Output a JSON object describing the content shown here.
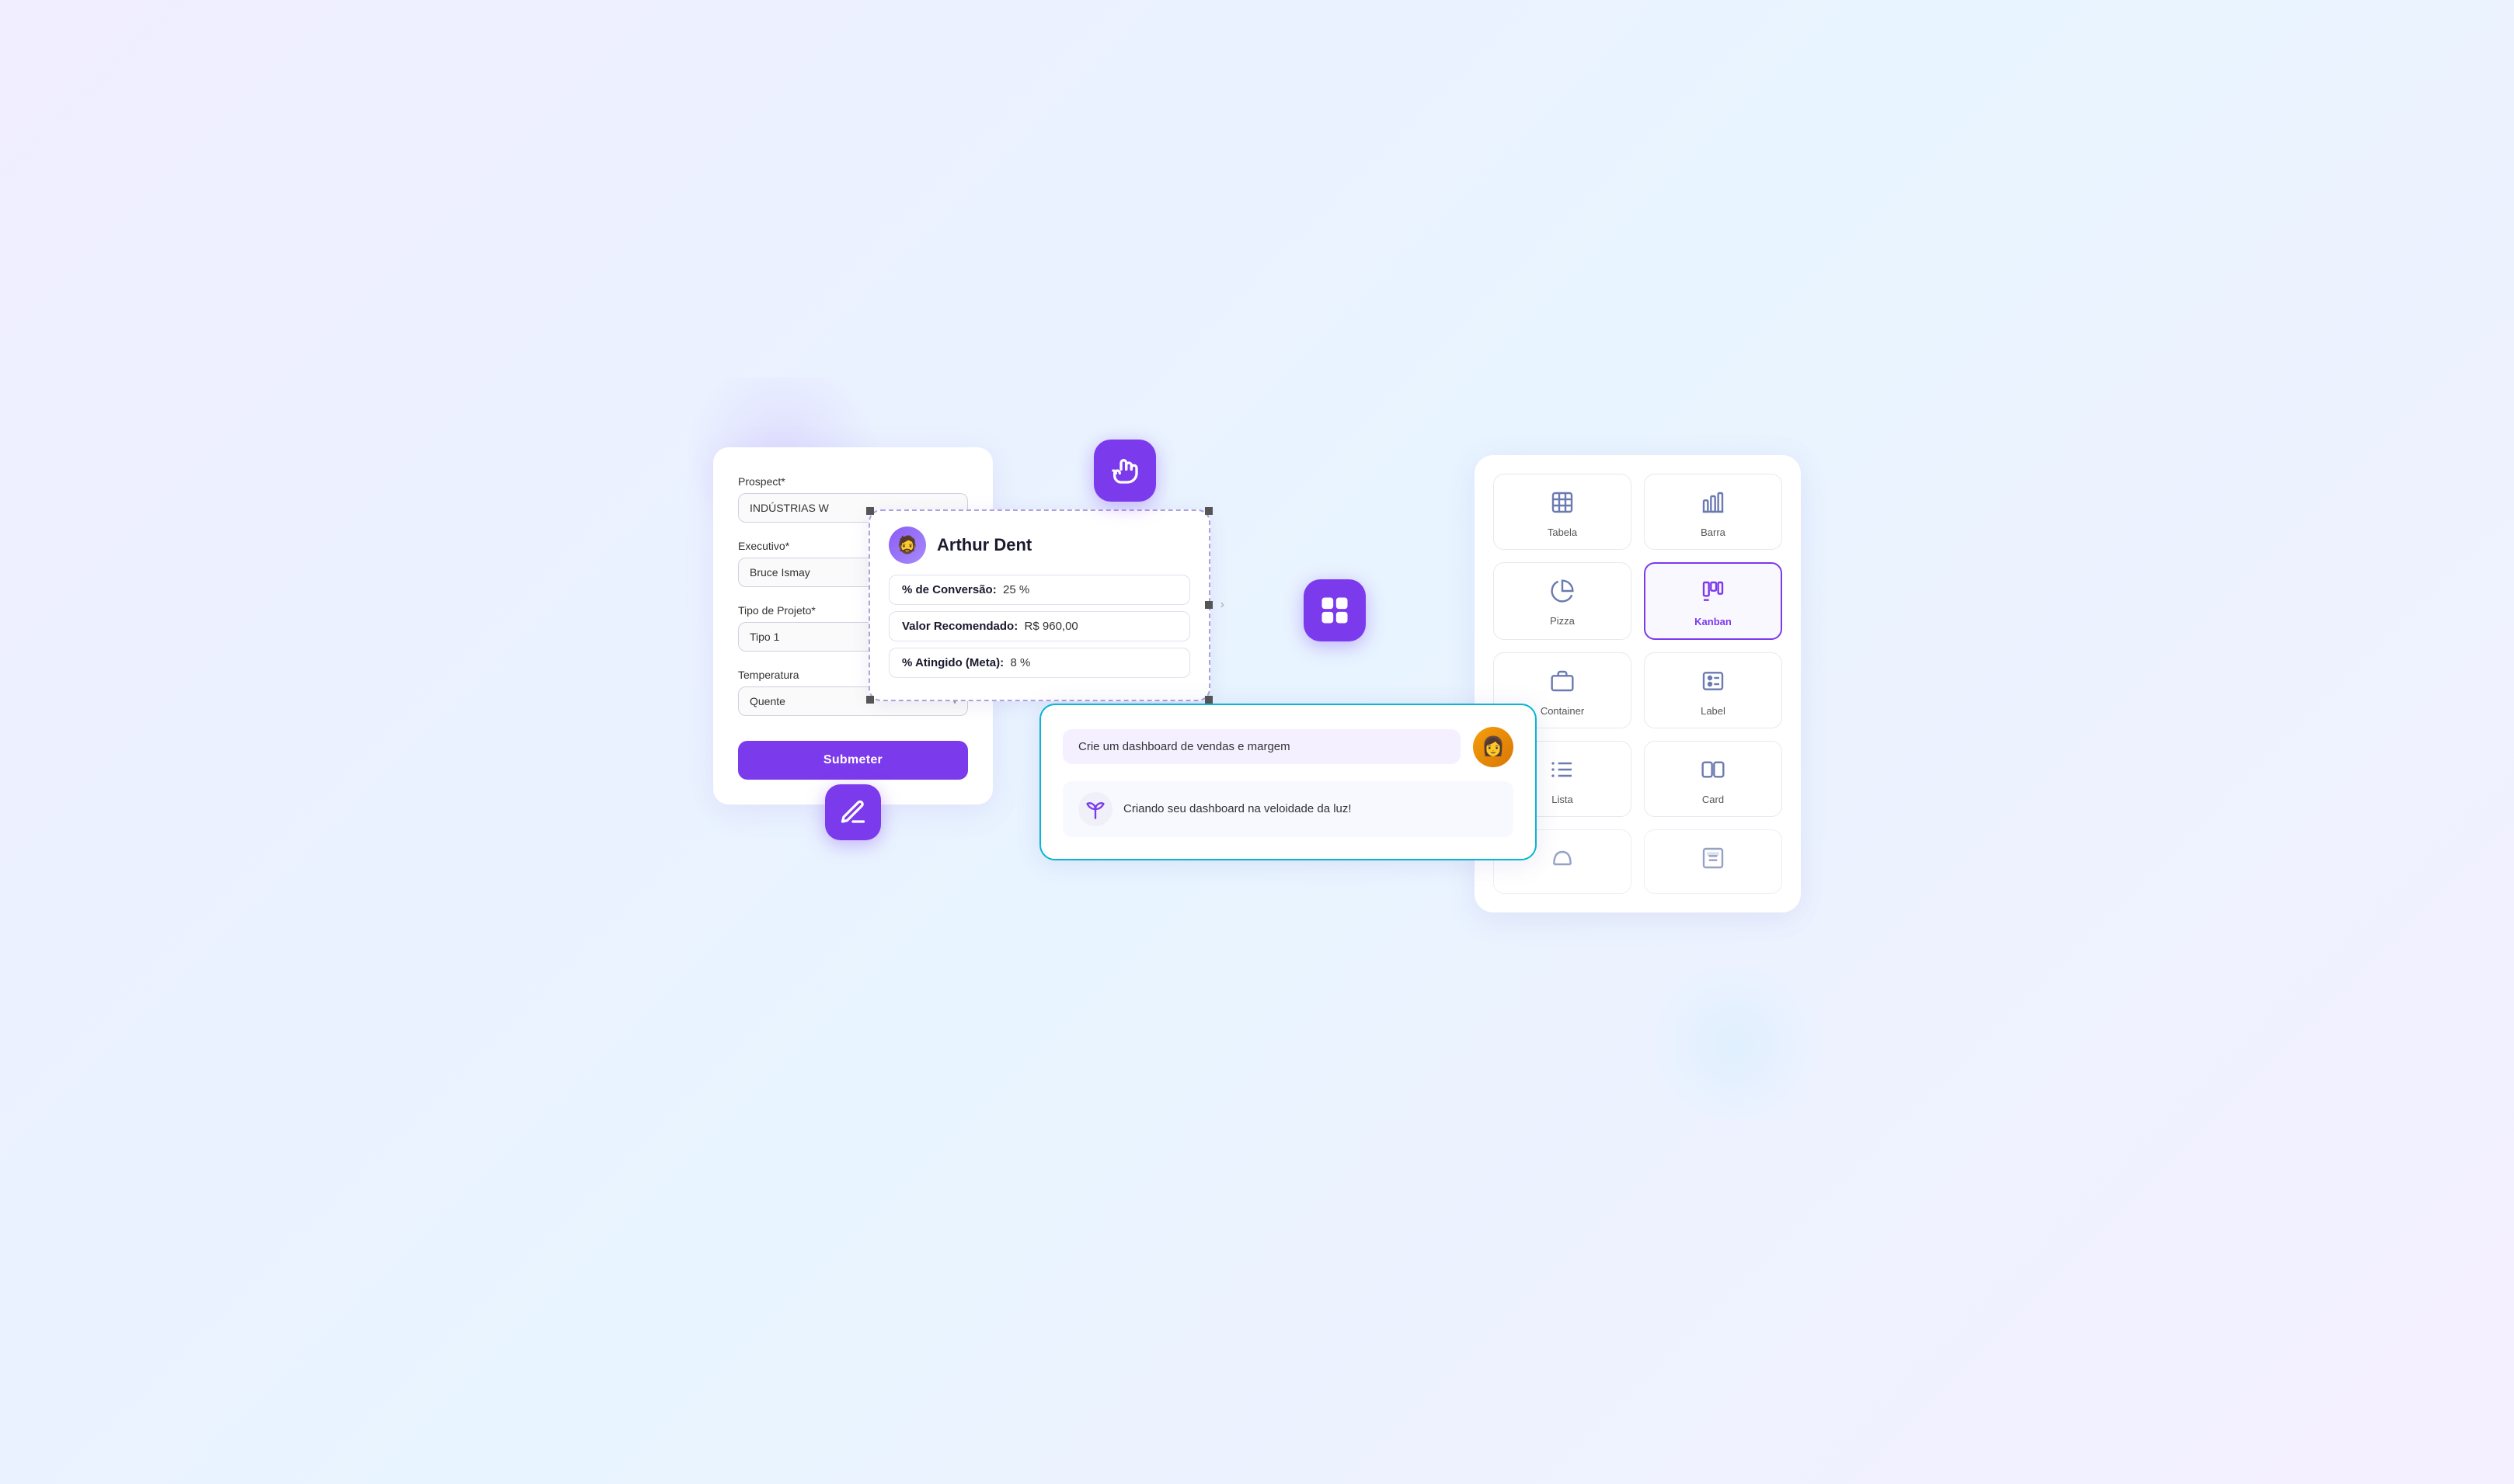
{
  "form": {
    "prospect_label": "Prospect*",
    "prospect_value": "INDÚSTRIAS W",
    "executivo_label": "Executivo*",
    "executivo_value": "Bruce Ismay",
    "tipo_label": "Tipo de Projeto*",
    "tipo_value": "Tipo 1",
    "temperatura_label": "Temperatura",
    "temperatura_value": "Quente",
    "submit_label": "Submeter"
  },
  "profile": {
    "name": "Arthur Dent",
    "conversao_label": "% de Conversão:",
    "conversao_value": "25 %",
    "valor_label": "Valor Recomendado:",
    "valor_value": "R$ 960,00",
    "atingido_label": "% Atingido (Meta):",
    "atingido_value": "8 %"
  },
  "chat": {
    "user_message": "Crie um dashboard de vendas e margem",
    "ai_message": "Criando seu dashboard na veloidade da luz!"
  },
  "chart_picker": {
    "items": [
      {
        "id": "tabela",
        "label": "Tabela",
        "active": false
      },
      {
        "id": "barra",
        "label": "Barra",
        "active": false
      },
      {
        "id": "pizza",
        "label": "Pizza",
        "active": false
      },
      {
        "id": "kanban",
        "label": "Kanban",
        "active": true
      },
      {
        "id": "container",
        "label": "Container",
        "active": false
      },
      {
        "id": "label",
        "label": "Label",
        "active": false
      },
      {
        "id": "lista",
        "label": "Lista",
        "active": false
      },
      {
        "id": "card",
        "label": "Card",
        "active": false
      },
      {
        "id": "col1",
        "label": "",
        "active": false
      },
      {
        "id": "col2",
        "label": "",
        "active": false
      }
    ]
  },
  "colors": {
    "purple": "#7c3aed",
    "cyan": "#06b6d4"
  }
}
